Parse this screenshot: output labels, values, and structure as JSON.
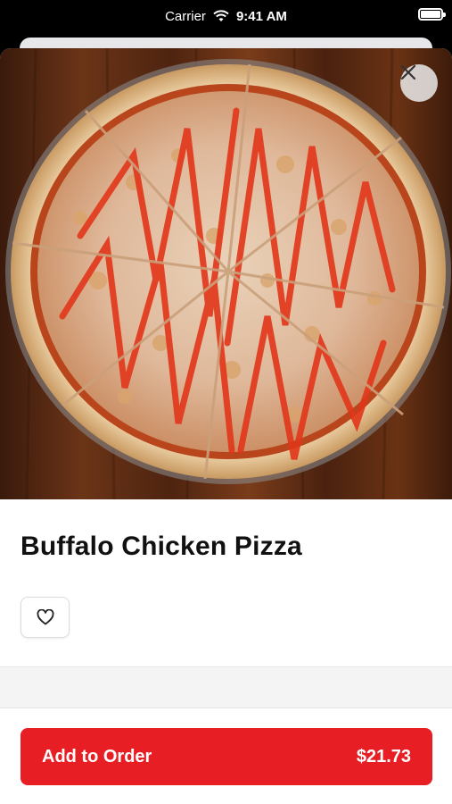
{
  "status_bar": {
    "carrier": "Carrier",
    "time": "9:41 AM",
    "wifi_icon": "wifi-icon",
    "battery_icon": "battery-icon"
  },
  "item": {
    "title": "Buffalo Chicken Pizza",
    "image": "pizza-photo",
    "favorite_icon": "heart-icon",
    "close_icon": "close-icon"
  },
  "footer": {
    "add_label": "Add to Order",
    "price": "$21.73"
  },
  "colors": {
    "accent": "#e81e25",
    "background": "#ffffff"
  }
}
